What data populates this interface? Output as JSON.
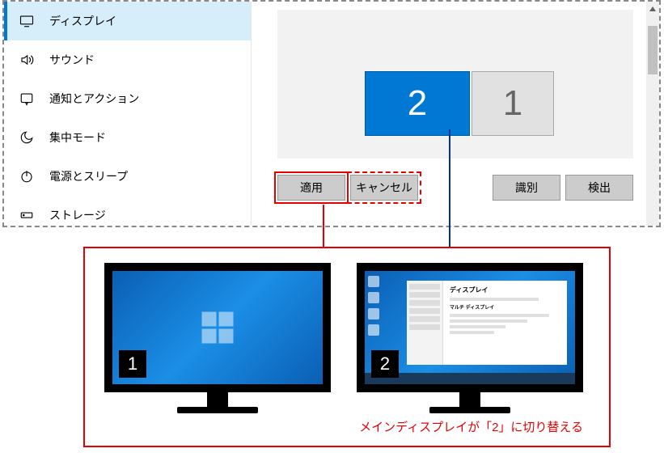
{
  "sidebar": {
    "items": [
      {
        "label": "ディスプレイ",
        "active": true,
        "icon": "display"
      },
      {
        "label": "サウンド",
        "active": false,
        "icon": "sound"
      },
      {
        "label": "通知とアクション",
        "active": false,
        "icon": "notifications"
      },
      {
        "label": "集中モード",
        "active": false,
        "icon": "focus"
      },
      {
        "label": "電源とスリープ",
        "active": false,
        "icon": "power"
      },
      {
        "label": "ストレージ",
        "active": false,
        "icon": "storage"
      }
    ]
  },
  "displays": {
    "selected": {
      "number": "2"
    },
    "unselected": {
      "number": "1"
    }
  },
  "buttons": {
    "apply": "適用",
    "cancel": "キャンセル",
    "identify": "識別",
    "detect": "検出"
  },
  "result": {
    "monitor1_label": "1",
    "monitor2_label": "2",
    "settings_title": "ディスプレイ",
    "settings_sub": "マルチ ディスプレイ",
    "caption": "メインディスプレイが「2」に切り替える"
  }
}
